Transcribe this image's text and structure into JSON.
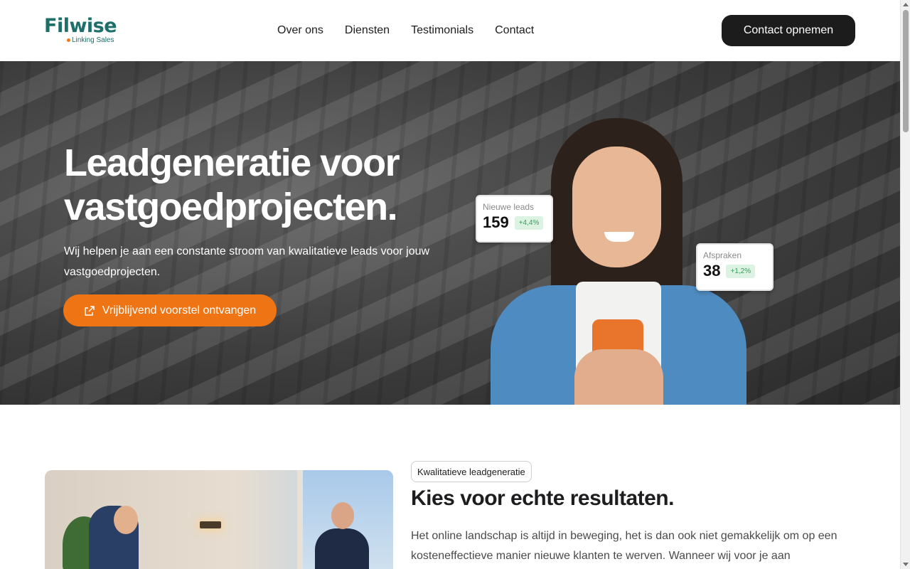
{
  "header": {
    "logo_text": "Filwise",
    "logo_tagline": "Linking Sales",
    "nav_items": [
      "Over ons",
      "Diensten",
      "Testimonials",
      "Contact"
    ],
    "cta_label": "Contact opnemen"
  },
  "hero": {
    "title": "Leadgeneratie voor vastgoedprojecten.",
    "subtitle": "Wij helpen je aan een constante stroom van kwalitatieve leads voor jouw vastgoedprojecten.",
    "cta_label": "Vrijblijvend voorstel ontvangen",
    "cta_icon": "external-link-icon",
    "stats": [
      {
        "label": "Nieuwe leads",
        "value": "159",
        "delta": "+4,4%"
      },
      {
        "label": "Afspraken",
        "value": "38",
        "delta": "+1,2%"
      }
    ]
  },
  "section": {
    "tag": "Kwalitatieve leadgeneratie",
    "title": "Kies voor echte resultaten.",
    "text": "Het online landschap is altijd in beweging, het is dan ook niet gemakkelijk om op een kosteneffectieve manier nieuwe klanten te werven. Wanneer wij voor je aan"
  },
  "colors": {
    "brand": "#1e6f6a",
    "accent": "#ef7413",
    "dark_button": "#1c1c1c"
  }
}
